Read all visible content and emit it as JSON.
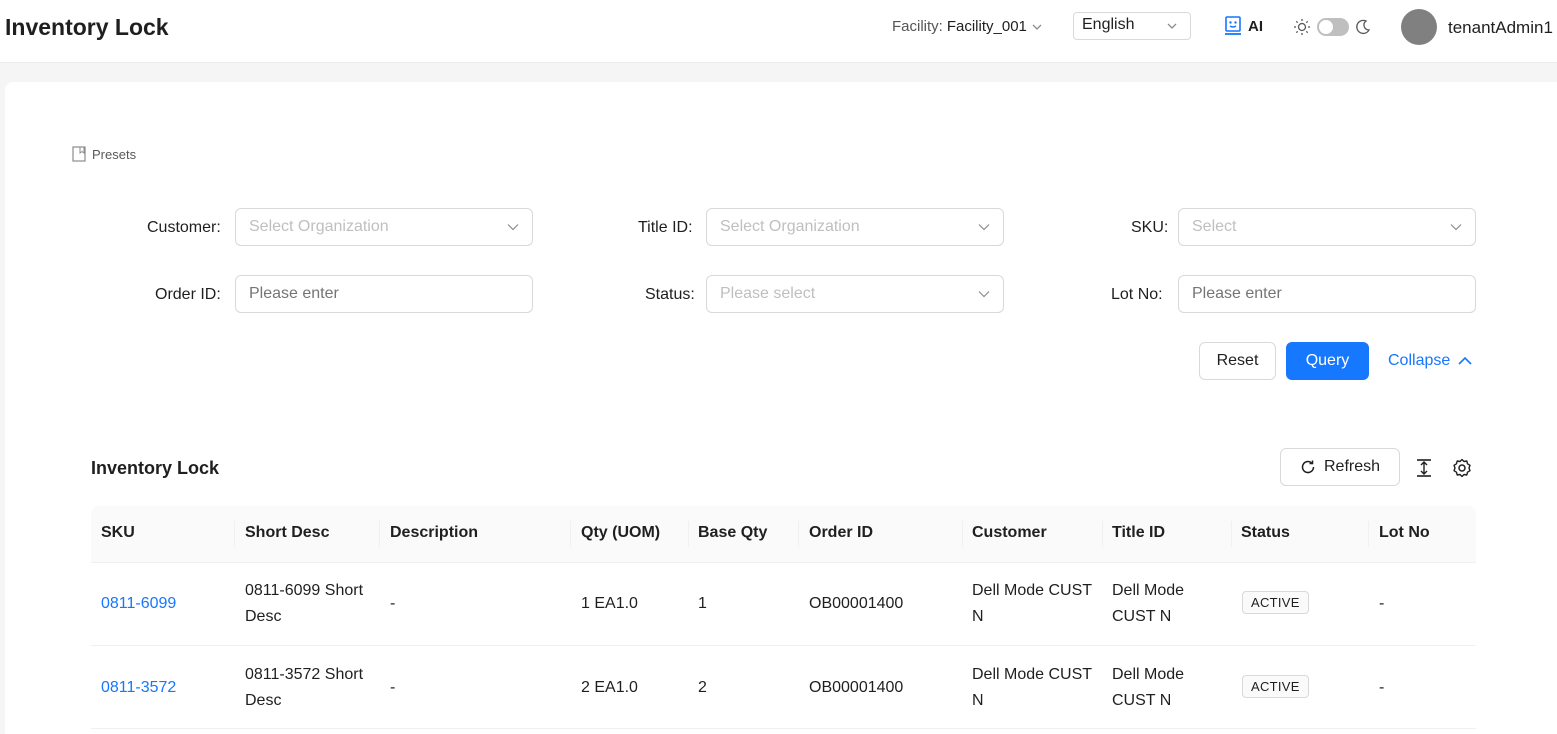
{
  "header": {
    "title": "Inventory Lock",
    "facility_label": "Facility:",
    "facility_value": "Facility_001",
    "language": "English",
    "ai_label": "AI",
    "username": "tenantAdmin1"
  },
  "filters": {
    "presets_label": "Presets",
    "customer": {
      "label": "Customer",
      "placeholder": "Select Organization"
    },
    "title_id": {
      "label": "Title ID",
      "placeholder": "Select Organization"
    },
    "sku": {
      "label": "SKU",
      "placeholder": "Select"
    },
    "order_id": {
      "label": "Order ID",
      "placeholder": "Please enter"
    },
    "status": {
      "label": "Status",
      "placeholder": "Please select"
    },
    "lot_no": {
      "label": "Lot No",
      "placeholder": "Please enter"
    },
    "reset_label": "Reset",
    "query_label": "Query",
    "collapse_label": "Collapse"
  },
  "table": {
    "title": "Inventory Lock",
    "refresh_label": "Refresh",
    "columns": [
      "SKU",
      "Short Desc",
      "Description",
      "Qty (UOM)",
      "Base Qty",
      "Order ID",
      "Customer",
      "Title ID",
      "Status",
      "Lot No"
    ],
    "rows": [
      {
        "sku": "0811-6099",
        "short_desc_1": "0811-6099 Short",
        "short_desc_2": "Desc",
        "description": "-",
        "qty_uom": "1 EA1.0",
        "base_qty": "1",
        "order_id": "OB00001400",
        "customer_1": "Dell Mode CUST",
        "customer_2": "N",
        "title_1": "Dell Mode",
        "title_2": "CUST N",
        "status": "ACTIVE",
        "lot_no": "-"
      },
      {
        "sku": "0811-3572",
        "short_desc_1": "0811-3572 Short",
        "short_desc_2": "Desc",
        "description": "-",
        "qty_uom": "2 EA1.0",
        "base_qty": "2",
        "order_id": "OB00001400",
        "customer_1": "Dell Mode CUST",
        "customer_2": "N",
        "title_1": "Dell Mode",
        "title_2": "CUST N",
        "status": "ACTIVE",
        "lot_no": "-"
      }
    ]
  },
  "colors": {
    "primary": "#1677ff",
    "avatar": "#808080"
  }
}
